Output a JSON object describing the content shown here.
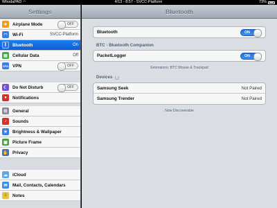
{
  "status_bar": {
    "carrier": "WhodaPAD",
    "time": "4/13 - 8:57 - SVCC-Platform",
    "battery": "73%",
    "battery_level": 0.73
  },
  "master": {
    "title": "Settings",
    "items": [
      {
        "label": "Airplane Mode",
        "toggle": "OFF",
        "icon": "airplane-icon",
        "color": "#f29a1b"
      },
      {
        "label": "Wi-Fi",
        "value": "SVCC-Platform",
        "icon": "wifi-icon",
        "color": "#3a7ee6"
      },
      {
        "label": "Bluetooth",
        "value": "On",
        "icon": "bluetooth-icon",
        "color": "#2b72e6",
        "selected": true
      },
      {
        "label": "Cellular Data",
        "value": "Off",
        "icon": "cellular-icon",
        "color": "#3fae48"
      },
      {
        "label": "VPN",
        "toggle": "OFF",
        "icon": "vpn-icon",
        "color": "#3a7ee6"
      },
      {
        "label": "Do Not Disturb",
        "toggle": "OFF",
        "icon": "moon-icon",
        "color": "#7a4ed0"
      },
      {
        "label": "Notifications",
        "icon": "notifications-icon",
        "color": "#d0322e"
      },
      {
        "label": "General",
        "icon": "gear-icon",
        "color": "#8a8f96"
      },
      {
        "label": "Sounds",
        "icon": "speaker-icon",
        "color": "#d0322e"
      },
      {
        "label": "Brightness & Wallpaper",
        "icon": "brightness-icon",
        "color": "#3a7ee6"
      },
      {
        "label": "Picture Frame",
        "icon": "picture-frame-icon",
        "color": "#4f9e4c"
      },
      {
        "label": "Privacy",
        "icon": "hand-icon",
        "color": "#4e6fb6"
      },
      {
        "label": "iCloud",
        "icon": "cloud-icon",
        "color": "#5fa8e8"
      },
      {
        "label": "Mail, Contacts, Calendars",
        "icon": "mail-icon",
        "color": "#3a8ee6"
      },
      {
        "label": "Notes",
        "icon": "notes-icon",
        "color": "#e6c24a"
      }
    ]
  },
  "detail": {
    "title": "Bluetooth",
    "bluetooth_row": {
      "label": "Bluetooth",
      "toggle": "ON"
    },
    "btc_section_title": "BTC - Bluetooth Companion",
    "packetlogger_row": {
      "label": "PacketLogger",
      "toggle": "ON"
    },
    "extensions_note": "Extensions: BTC Mouse & Trackpad",
    "devices_section_title": "Devices",
    "devices": [
      {
        "name": "Samsung Seek",
        "status": "Not Paired"
      },
      {
        "name": "Samsung Trender",
        "status": "Not Paired"
      }
    ],
    "discoverable_note": "Now Discoverable"
  }
}
